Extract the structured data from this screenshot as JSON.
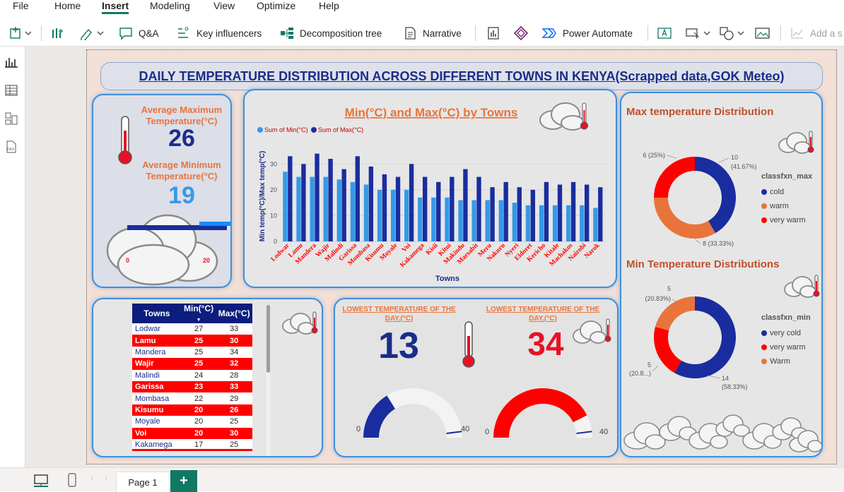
{
  "menu": {
    "items": [
      "File",
      "Home",
      "Insert",
      "Modeling",
      "View",
      "Optimize",
      "Help"
    ],
    "active": "Insert"
  },
  "toolbar": {
    "qa": "Q&A",
    "key_influencers": "Key influencers",
    "decomposition_tree": "Decomposition tree",
    "narrative": "Narrative",
    "power_automate": "Power Automate",
    "add_smart": "Add a s"
  },
  "report": {
    "title": "DAILY TEMPERATURE DISTRIBUTION ACROSS DIFFERENT TOWNS IN KENYA(Scrapped data,GOK Meteo)",
    "kpi": {
      "avg_max_label": "Average Maximum Temperature(°C)",
      "avg_max_value": "26",
      "avg_min_label": "Average Minimum Temperature(°C)",
      "avg_min_value": "19",
      "slider_min": "0",
      "slider_max": "20",
      "slider_level": 0.95
    },
    "table": {
      "headers": [
        "Towns",
        "Min(°C)",
        "Max(°C)"
      ],
      "rows": [
        [
          "Lodwar",
          "27",
          "33"
        ],
        [
          "Lamu",
          "25",
          "30"
        ],
        [
          "Mandera",
          "25",
          "34"
        ],
        [
          "Wajir",
          "25",
          "32"
        ],
        [
          "Malindi",
          "24",
          "28"
        ],
        [
          "Garissa",
          "23",
          "33"
        ],
        [
          "Mombasa",
          "22",
          "29"
        ],
        [
          "Kisumu",
          "20",
          "26"
        ],
        [
          "Moyale",
          "20",
          "25"
        ],
        [
          "Voi",
          "20",
          "30"
        ],
        [
          "Kakamega",
          "17",
          "25"
        ]
      ]
    },
    "gauges": {
      "lowest_label": "LOWEST TEMPERATURE OF THE DAY.(°C)",
      "lowest_value": "13",
      "lowest_min": "0",
      "lowest_max": "40",
      "highest_label": "LOWEST TEMPERATURE OF THE DAY.(°C)",
      "highest_value": "34",
      "highest_min": "0",
      "highest_max": "40"
    },
    "max_pie": {
      "title": "Max temperature Distribution",
      "legend_title": "classfxn_max",
      "labels": {
        "cold": "10",
        "cold_pct": "(41.67%)",
        "warm": "8 (33.33%)",
        "very_warm": "6 (25%)"
      }
    },
    "min_pie": {
      "title": "Min Temperature Distributions",
      "legend_title": "classfxn_min",
      "labels": {
        "very_cold": "14",
        "very_cold_pct": "(58.33%)",
        "very_warm": "5",
        "very_warm_pct": "(20.8...)",
        "warm": "5",
        "warm_pct": "(20.83%)"
      }
    }
  },
  "chart_data": [
    {
      "type": "bar",
      "title": "Min(°C) and Max(°C) by Towns",
      "xlabel": "Towns",
      "ylabel": "Min temp(°C)/Max temp(°C)",
      "ylim": [
        0,
        35
      ],
      "yticks": [
        0,
        10,
        20,
        30
      ],
      "legend_position": "top-left",
      "categories": [
        "Lodwar",
        "Lamu",
        "Mandera",
        "Wajir",
        "Malindi",
        "Garissa",
        "Mombasa",
        "Kisumu",
        "Moyale",
        "Voi",
        "Kakamega",
        "Kisii",
        "Kitui",
        "Makindu",
        "Marsabit",
        "Meru",
        "Nakuru",
        "Nyeri",
        "Eldoret",
        "Kericho",
        "Kitale",
        "Machakos",
        "Nairobi",
        "Narok"
      ],
      "series": [
        {
          "name": "Sum of Min(°C)",
          "color": "#3599e8",
          "values": [
            27,
            25,
            25,
            25,
            24,
            23,
            22,
            20,
            20,
            20,
            17,
            17,
            17,
            16,
            16,
            16,
            16,
            15,
            14,
            14,
            14,
            14,
            14,
            13
          ]
        },
        {
          "name": "Sum of Max(°C)",
          "color": "#1a2d9e",
          "values": [
            33,
            30,
            34,
            32,
            28,
            33,
            29,
            26,
            25,
            30,
            25,
            23,
            25,
            28,
            25,
            21,
            23,
            21,
            20,
            23,
            22,
            23,
            22,
            21
          ]
        }
      ]
    },
    {
      "type": "pie",
      "title": "Max temperature Distribution",
      "legend_title": "classfxn_max",
      "categories": [
        "cold",
        "warm",
        "very warm"
      ],
      "values": [
        10,
        8,
        6
      ],
      "colors": [
        "#1a2d9e",
        "#e8743b",
        "#ff0000"
      ]
    },
    {
      "type": "pie",
      "title": "Min Temperature Distributions",
      "legend_title": "classfxn_min",
      "categories": [
        "very cold",
        "very warm",
        "Warm"
      ],
      "values": [
        14,
        5,
        5
      ],
      "colors": [
        "#1a2d9e",
        "#ff0000",
        "#e8743b"
      ]
    }
  ],
  "status": {
    "page_tab": "Page 1",
    "add_page": "+"
  }
}
